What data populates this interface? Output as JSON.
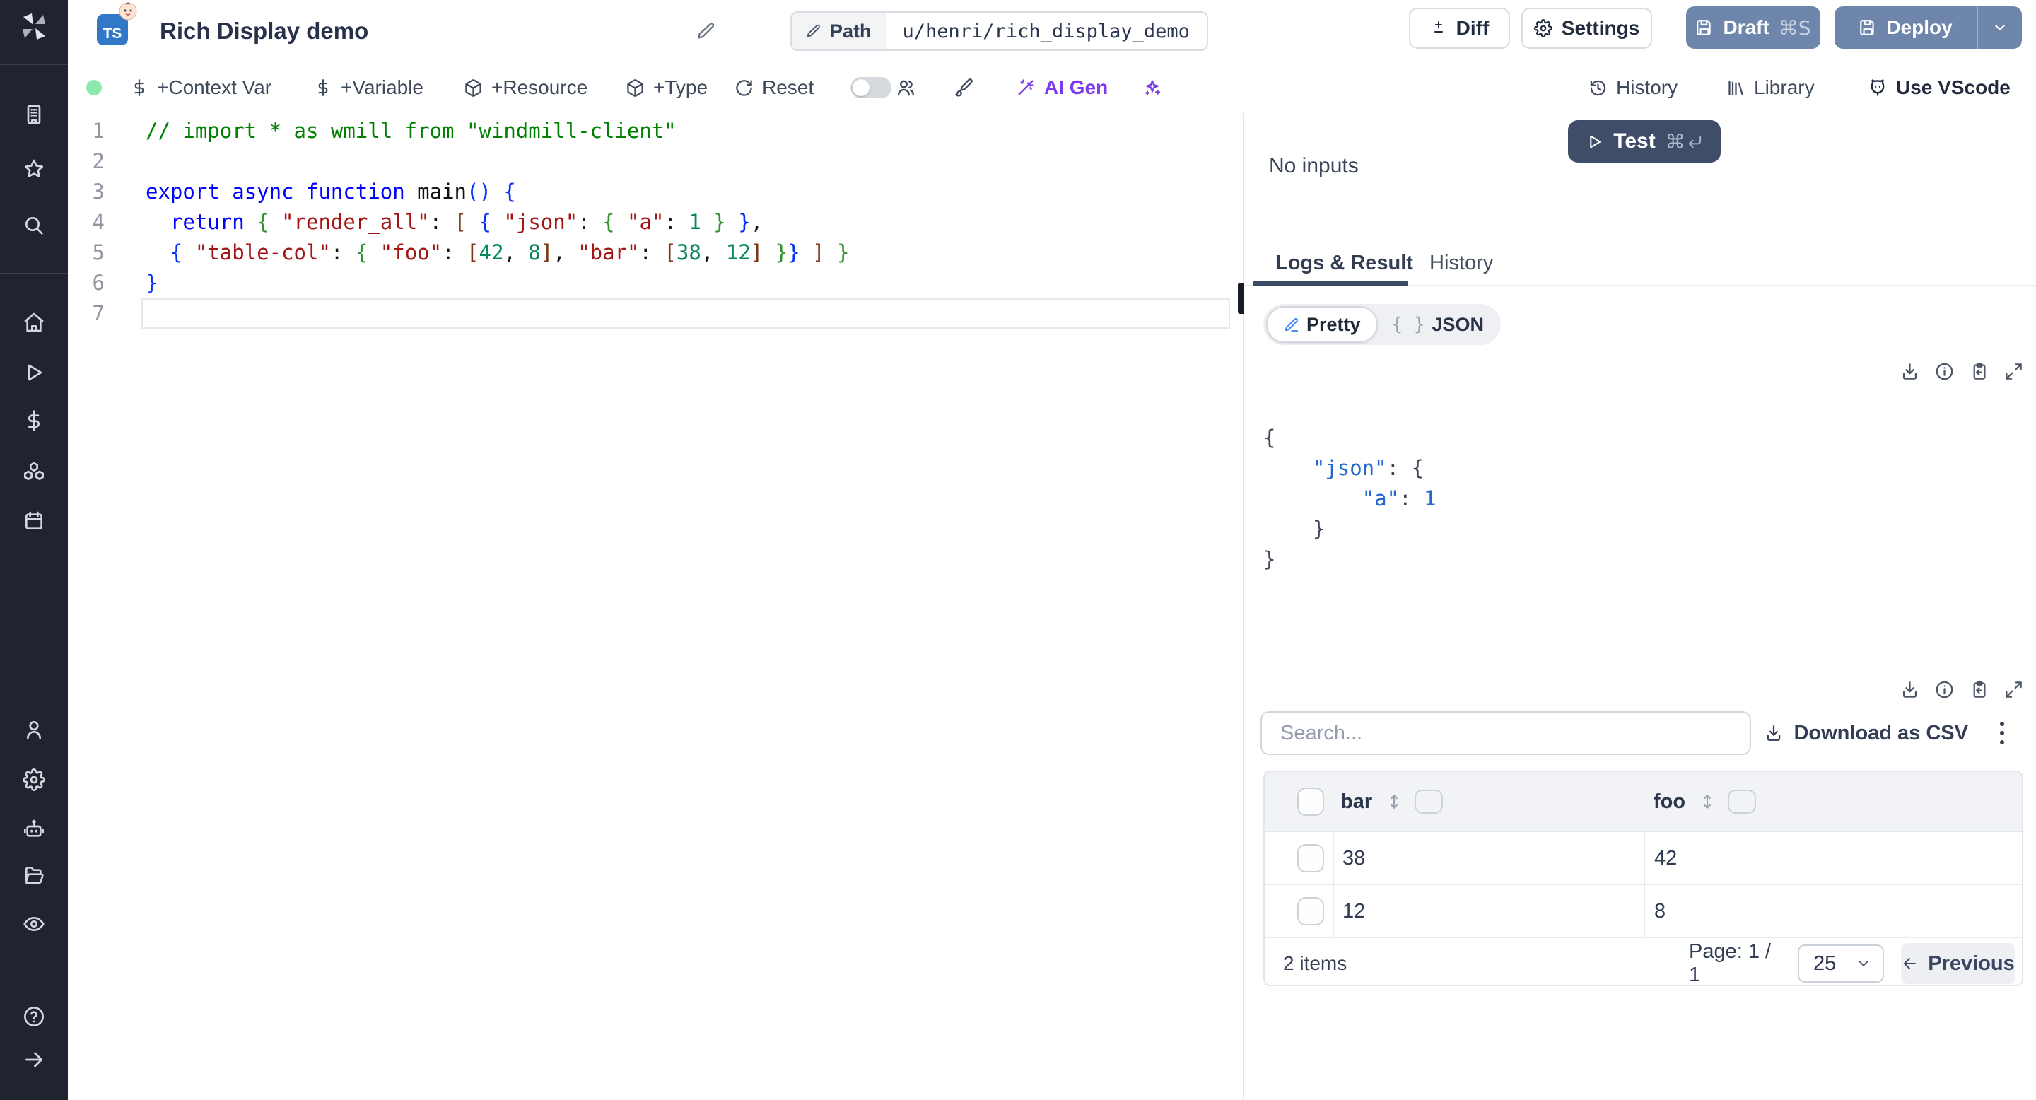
{
  "header": {
    "title": "Rich Display demo",
    "language_badge": "TS",
    "path_label": "Path",
    "path_value": "u/henri/rich_display_demo",
    "diff_label": "Diff",
    "settings_label": "Settings",
    "draft_label": "Draft",
    "draft_shortcut": "⌘S",
    "deploy_label": "Deploy"
  },
  "toolbar": {
    "context_var": "+Context Var",
    "variable": "+Variable",
    "resource": "+Resource",
    "type": "+Type",
    "reset": "Reset",
    "ai_gen": "AI Gen",
    "history": "History",
    "library": "Library",
    "vscode": "Use VScode"
  },
  "editor": {
    "current_line": 7,
    "lines": [
      [
        [
          "cmt",
          "// import * as wmill from \"windmill-client\""
        ]
      ],
      [],
      [
        [
          "kw",
          "export"
        ],
        [
          "pl",
          " "
        ],
        [
          "kw",
          "async"
        ],
        [
          "pl",
          " "
        ],
        [
          "kw",
          "function"
        ],
        [
          "fn",
          " main"
        ],
        [
          "b1",
          "("
        ],
        [
          "b1",
          ")"
        ],
        [
          "pl",
          " "
        ],
        [
          "b1",
          "{"
        ]
      ],
      [
        [
          "pl",
          "  "
        ],
        [
          "kw",
          "return"
        ],
        [
          "pl",
          " "
        ],
        [
          "b2",
          "{"
        ],
        [
          "pl",
          " "
        ],
        [
          "str",
          "\"render_all\""
        ],
        [
          "pl",
          ": "
        ],
        [
          "b3",
          "["
        ],
        [
          "pl",
          " "
        ],
        [
          "b1",
          "{"
        ],
        [
          "pl",
          " "
        ],
        [
          "str",
          "\"json\""
        ],
        [
          "pl",
          ": "
        ],
        [
          "b2",
          "{"
        ],
        [
          "pl",
          " "
        ],
        [
          "str",
          "\"a\""
        ],
        [
          "pl",
          ": "
        ],
        [
          "num",
          "1"
        ],
        [
          "pl",
          " "
        ],
        [
          "b2",
          "}"
        ],
        [
          "pl",
          " "
        ],
        [
          "b1",
          "}"
        ],
        [
          "pl",
          ","
        ]
      ],
      [
        [
          "pl",
          "  "
        ],
        [
          "b1",
          "{"
        ],
        [
          "pl",
          " "
        ],
        [
          "str",
          "\"table-col\""
        ],
        [
          "pl",
          ": "
        ],
        [
          "b2",
          "{"
        ],
        [
          "pl",
          " "
        ],
        [
          "str",
          "\"foo\""
        ],
        [
          "pl",
          ": "
        ],
        [
          "b3",
          "["
        ],
        [
          "num",
          "42"
        ],
        [
          "pl",
          ", "
        ],
        [
          "num",
          "8"
        ],
        [
          "b3",
          "]"
        ],
        [
          "pl",
          ", "
        ],
        [
          "str",
          "\"bar\""
        ],
        [
          "pl",
          ": "
        ],
        [
          "b3",
          "["
        ],
        [
          "num",
          "38"
        ],
        [
          "pl",
          ", "
        ],
        [
          "num",
          "12"
        ],
        [
          "b3",
          "]"
        ],
        [
          "pl",
          " "
        ],
        [
          "b2",
          "}"
        ],
        [
          "b1",
          "}"
        ],
        [
          "pl",
          " "
        ],
        [
          "b3",
          "]"
        ],
        [
          "pl",
          " "
        ],
        [
          "b2",
          "}"
        ]
      ],
      [
        [
          "b1",
          "}"
        ]
      ],
      []
    ]
  },
  "runner": {
    "test_label": "Test",
    "test_shortcut_cmd": "⌘",
    "no_inputs": "No inputs",
    "tab_logs": "Logs & Result",
    "tab_history": "History",
    "pretty_label": "Pretty",
    "json_label": "JSON",
    "json_icon": "{ }",
    "result_lines": [
      [
        [
          "jp",
          "{"
        ]
      ],
      [
        [
          "jw",
          "    "
        ],
        [
          "jk",
          "\"json\""
        ],
        [
          "jp",
          ": {"
        ]
      ],
      [
        [
          "jw",
          "        "
        ],
        [
          "jk",
          "\"a\""
        ],
        [
          "jp",
          ": "
        ],
        [
          "jn",
          "1"
        ]
      ],
      [
        [
          "jw",
          "    "
        ],
        [
          "jp",
          "}"
        ]
      ],
      [
        [
          "jp",
          "}"
        ]
      ]
    ]
  },
  "table": {
    "search_placeholder": "Search...",
    "download_csv": "Download as CSV",
    "columns": [
      "bar",
      "foo"
    ],
    "rows": [
      [
        "38",
        "42"
      ],
      [
        "12",
        "8"
      ]
    ],
    "items_label": "2 items",
    "page_label": "Page: 1 / 1",
    "page_size": "25",
    "previous_label": "Previous"
  },
  "colors": {
    "slate_button": "#6e86ab",
    "test_button": "#3f4d68",
    "ai_purple": "#7c3aed",
    "ts_badge": "#3178c6",
    "status_green": "#8ce8ad",
    "tab_underline": "#3c4a66"
  }
}
